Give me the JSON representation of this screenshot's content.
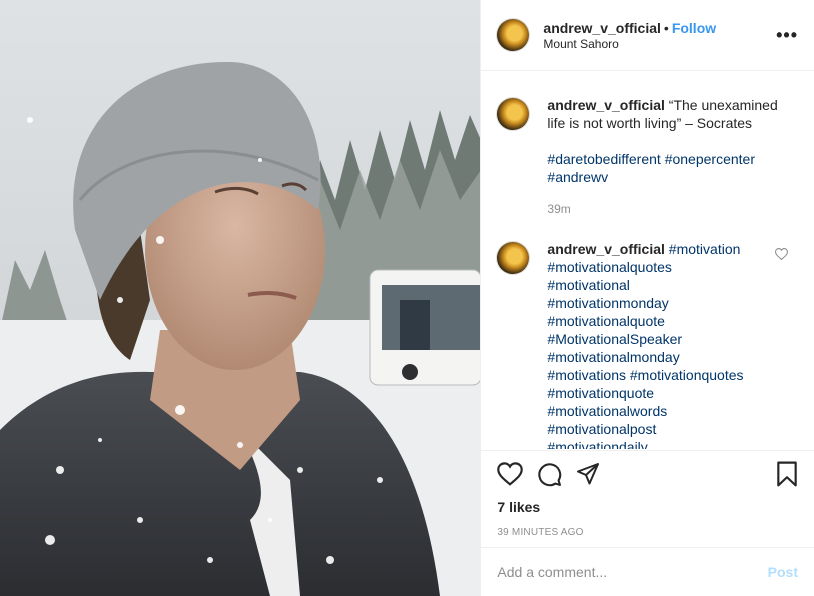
{
  "post": {
    "username": "andrew_v_official",
    "follow_label": "Follow",
    "separator": "•",
    "location": "Mount Sahoro",
    "more_icon": "more-horizontal-icon"
  },
  "caption": {
    "username": "andrew_v_official",
    "text": "“The unexamined life is not worth living” – Socrates",
    "hashtags": [
      "#daretobedifferent",
      "#onepercenter",
      "#andrewv"
    ],
    "time": "39m"
  },
  "comment": {
    "username": "andrew_v_official",
    "hashtags": [
      "#motivation",
      "#motivationalquotes",
      "#motivational",
      "#motivationmonday",
      "#motivationalquote",
      "#MotivationalSpeaker",
      "#motivationalmonday",
      "#motivations",
      "#motivationquotes",
      "#motivationquote",
      "#motivationalwords",
      "#motivationalpost",
      "#motivationdaily"
    ],
    "like_icon": "heart-outline-icon"
  },
  "actions": {
    "icons": [
      "heart-icon",
      "comment-icon",
      "share-icon",
      "bookmark-icon"
    ],
    "likes": "7 likes",
    "posted_ago": "39 MINUTES AGO"
  },
  "add_comment": {
    "placeholder": "Add a comment...",
    "post_label": "Post"
  },
  "colors": {
    "link": "#3897f0",
    "hashtag": "#003569",
    "muted": "#8e8e8e",
    "post_disabled": "#b2dffc"
  }
}
